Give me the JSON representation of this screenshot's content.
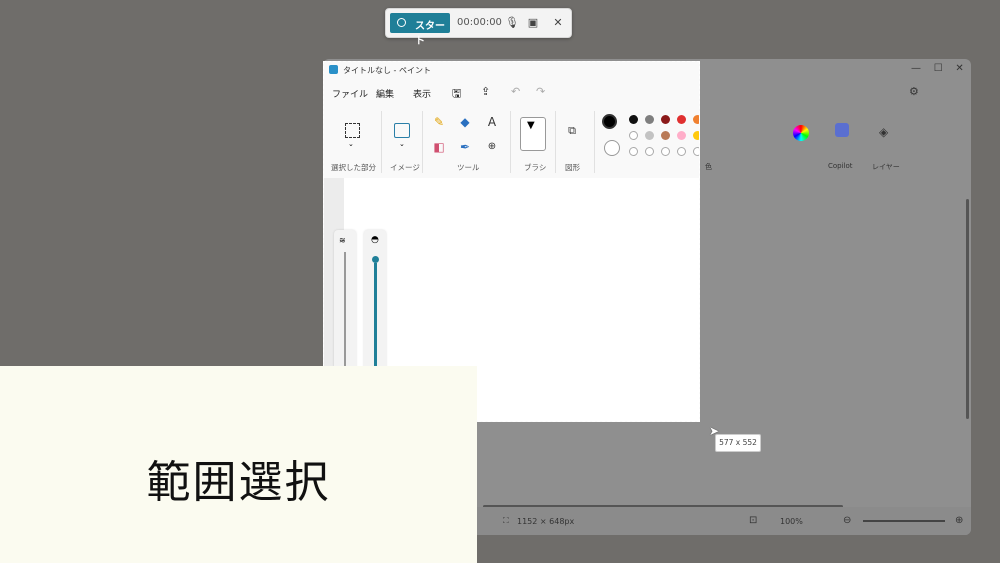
{
  "recording_bar": {
    "start_label": "スタート",
    "timer": "00:00:00",
    "icons": [
      "microphone-off-icon",
      "screen-icon",
      "close-icon"
    ]
  },
  "paint": {
    "title": "タイトルなし - ペイント",
    "menu": [
      "ファイル",
      "編集",
      "表示"
    ],
    "groups": [
      "選択した部分",
      "イメージ",
      "ツール",
      "ブラシ",
      "図形"
    ],
    "bg_labels": {
      "copilot": "Copilot",
      "layers": "レイヤー",
      "colors_partial": "色"
    },
    "palette_row1": [
      "#111111",
      "#7f7f7f",
      "#8b1a1a",
      "#e03030",
      "#f08030",
      "#e8c000",
      "#2ea44f",
      "#1aa0b0",
      "#3b4fc0",
      "#8a3fa0"
    ],
    "palette_row2": [
      "#ffffff",
      "#c3c3c3",
      "#b97a57",
      "#ffaec9",
      "#ffc90e"
    ],
    "status_dims": "1152 × 648px",
    "zoom": "100%"
  },
  "size_tooltip": "577 x 552",
  "caption": "範囲選択"
}
